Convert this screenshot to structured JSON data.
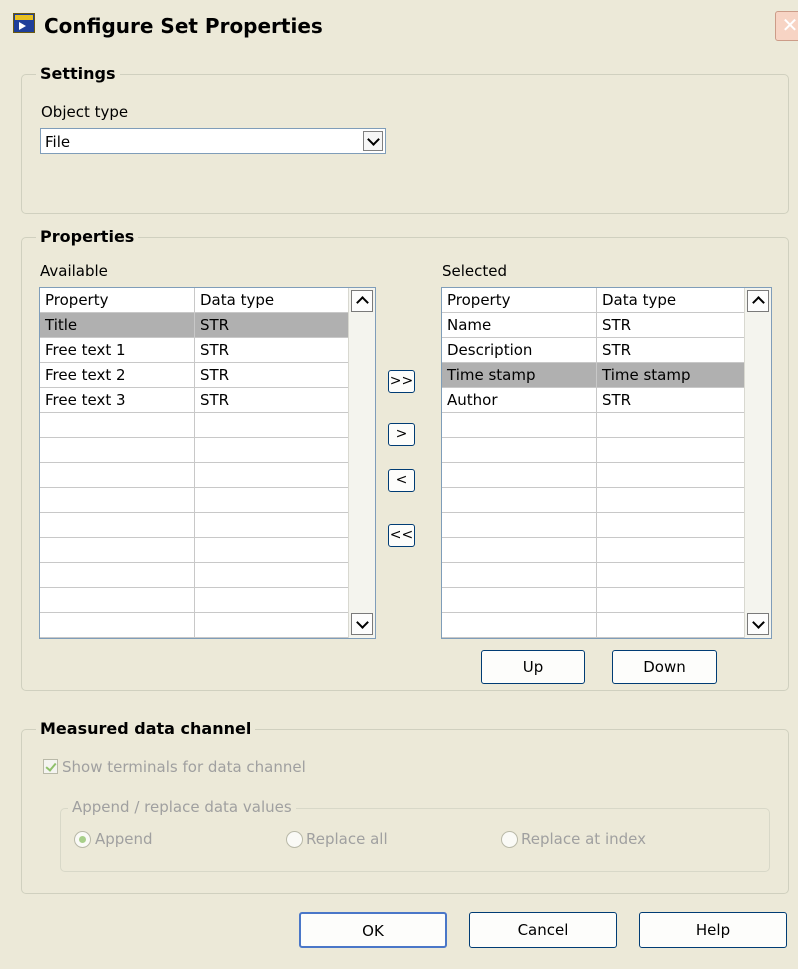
{
  "window": {
    "title": "Configure Set Properties",
    "close_glyph": "✕"
  },
  "settings": {
    "legend": "Settings",
    "object_type_label": "Object type",
    "object_type_value": "File"
  },
  "properties": {
    "legend": "Properties",
    "available_label": "Available",
    "selected_label": "Selected",
    "columns": [
      "Property",
      "Data type"
    ],
    "available_rows": [
      {
        "property": "Title",
        "data_type": "STR",
        "selected": true
      },
      {
        "property": "Free text 1",
        "data_type": "STR"
      },
      {
        "property": "Free text 2",
        "data_type": "STR"
      },
      {
        "property": "Free text 3",
        "data_type": "STR"
      }
    ],
    "selected_rows": [
      {
        "property": "Name",
        "data_type": "STR"
      },
      {
        "property": "Description",
        "data_type": "STR"
      },
      {
        "property": "Time stamp",
        "data_type": "Time stamp",
        "selected": true
      },
      {
        "property": "Author",
        "data_type": "STR"
      }
    ],
    "add_all_label": ">>",
    "add_label": ">",
    "remove_label": "<",
    "remove_all_label": "<<",
    "up_label": "Up",
    "down_label": "Down"
  },
  "measured": {
    "legend": "Measured data channel",
    "show_terminals_label": "Show terminals for data channel",
    "show_terminals_checked": true,
    "append_group_legend": "Append / replace data values",
    "options": [
      "Append",
      "Replace all",
      "Replace at index"
    ],
    "selected_option": "Append"
  },
  "footer": {
    "ok_label": "OK",
    "cancel_label": "Cancel",
    "help_label": "Help"
  }
}
